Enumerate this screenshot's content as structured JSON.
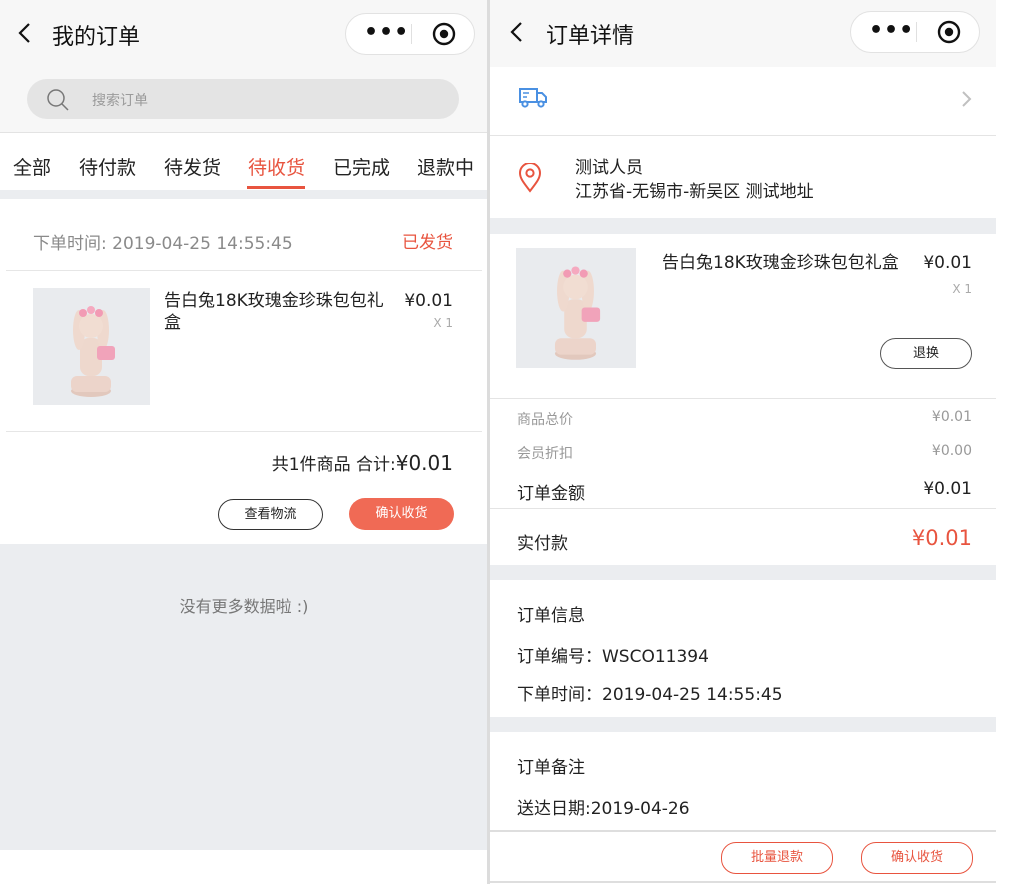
{
  "orders_page": {
    "title": "我的订单",
    "search_placeholder": "搜索订单",
    "tabs": [
      "全部",
      "待付款",
      "待发货",
      "待收货",
      "已完成",
      "退款中"
    ],
    "active_tab": "待收货",
    "order": {
      "time_label": "下单时间: 2019-04-25 14:55:45",
      "status": "已发货",
      "goods_name": "告白兔18K玫瑰金珍珠包包礼盒",
      "price": "¥0.01",
      "qty": "X 1",
      "summary_prefix": "共1件商品 合计:",
      "summary_amount": "¥0.01",
      "btn_logistics": "查看物流",
      "btn_confirm": "确认收货"
    },
    "no_more": "没有更多数据啦 :)"
  },
  "detail_page": {
    "title": "订单详情",
    "receiver_name": "测试人员",
    "receiver_address": "江苏省-无锡市-新吴区 测试地址",
    "goods_name": "告白兔18K玫瑰金珍珠包包礼盒",
    "price": "¥0.01",
    "qty": "X 1",
    "btn_return": "退换",
    "rows": {
      "goods_total_label": "商品总价",
      "goods_total_value": "¥0.01",
      "member_discount_label": "会员折扣",
      "member_discount_value": "¥0.00",
      "order_amount_label": "订单金额",
      "order_amount_value": "¥0.01",
      "paid_label": "实付款",
      "paid_value": "¥0.01"
    },
    "info": {
      "heading": "订单信息",
      "order_no": "订单编号：WSCO11394",
      "order_time": "下单时间：2019-04-25 14:55:45"
    },
    "remark": {
      "heading": "订单备注",
      "text": "送达日期:2019-04-26"
    },
    "btn_batch_refund": "批量退款",
    "btn_confirm": "确认收货"
  },
  "colors": {
    "accent": "#e8543f",
    "button_red": "#f06a55",
    "truck_icon": "#4a90e2",
    "background_grey": "#ebedf0"
  },
  "icons": [
    "back-arrow-icon",
    "more-dots-icon",
    "target-icon",
    "search-icon",
    "truck-icon",
    "chevron-right-icon",
    "location-pin-icon"
  ]
}
